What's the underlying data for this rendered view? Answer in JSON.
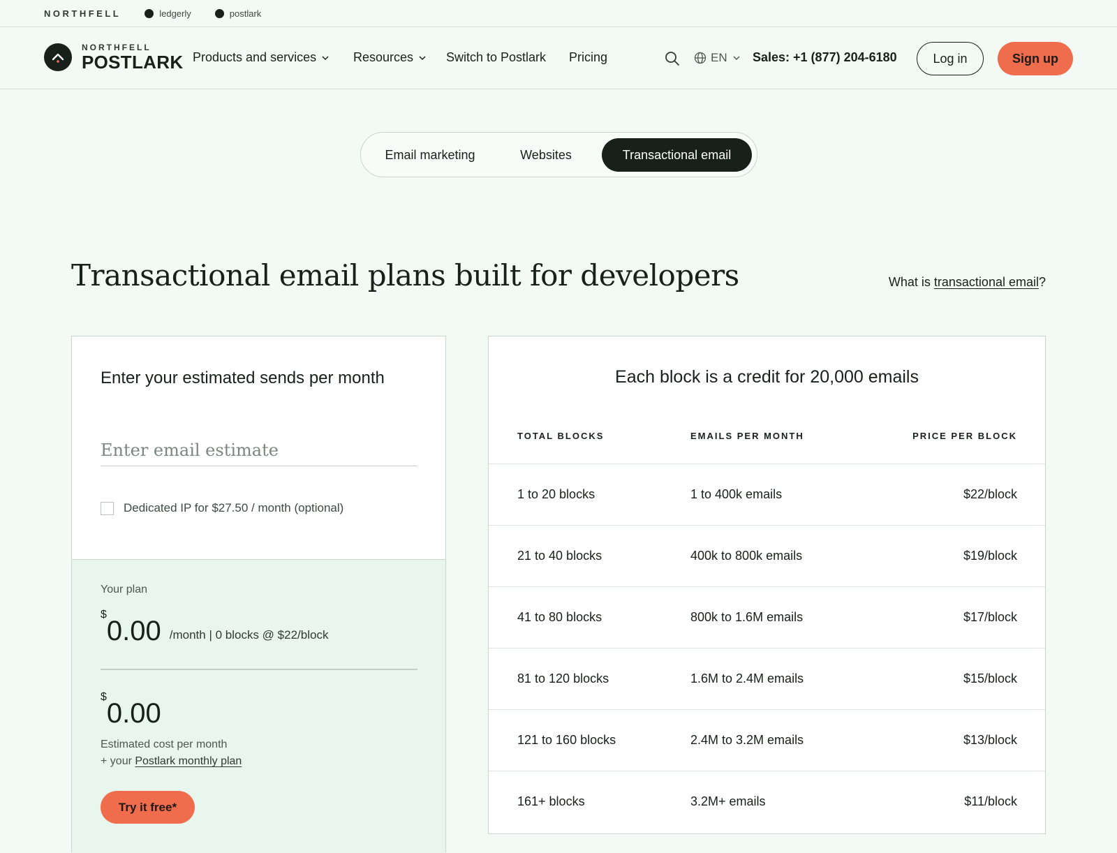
{
  "utility_bar": {
    "brand": "NORTHFELL",
    "links": [
      "ledgerly",
      "postlark"
    ]
  },
  "nav": {
    "logo_small": "NORTHFELL",
    "logo_big": "POSTLARK",
    "items": [
      {
        "label": "Products and services",
        "has_dropdown": true
      },
      {
        "label": "Resources",
        "has_dropdown": true
      },
      {
        "label": "Switch to Postlark",
        "has_dropdown": false
      },
      {
        "label": "Pricing",
        "has_dropdown": false
      }
    ],
    "language": "EN",
    "sales": "Sales: +1 (877) 204-6180",
    "login_label": "Log in",
    "signup_label": "Sign up"
  },
  "tabs": [
    {
      "label": "Email marketing",
      "active": false
    },
    {
      "label": "Websites",
      "active": false
    },
    {
      "label": "Transactional email",
      "active": true
    }
  ],
  "page": {
    "title": "Transactional email plans built for developers",
    "what_is_prefix": "What is ",
    "what_is_link": "transactional email",
    "what_is_suffix": "?"
  },
  "estimator": {
    "heading": "Enter your estimated sends per month",
    "input_placeholder": "Enter email estimate",
    "input_value": "",
    "dedicated_ip_label": "Dedicated IP for $27.50 / month (optional)",
    "dedicated_ip_checked": false,
    "plan_label": "Your plan",
    "currency": "$",
    "price": "0.00",
    "price_detail": "/month | 0 blocks @ $22/block",
    "total": "0.00",
    "estimated_label": "Estimated cost per month",
    "plan_note_prefix": "+ your ",
    "plan_note_link": "Postlark monthly plan",
    "try_label": "Try it free*"
  },
  "pricing_table": {
    "heading": "Each block is a credit for 20,000 emails",
    "columns": [
      "TOTAL BLOCKS",
      "EMAILS PER MONTH",
      "PRICE PER BLOCK"
    ],
    "rows": [
      {
        "blocks": "1 to 20 blocks",
        "emails": "1 to 400k emails",
        "price": "$22/block"
      },
      {
        "blocks": "21 to 40 blocks",
        "emails": "400k to 800k emails",
        "price": "$19/block"
      },
      {
        "blocks": "41 to 80 blocks",
        "emails": "800k to 1.6M emails",
        "price": "$17/block"
      },
      {
        "blocks": "81 to 120 blocks",
        "emails": "1.6M to 2.4M emails",
        "price": "$15/block"
      },
      {
        "blocks": "121 to 160 blocks",
        "emails": "2.4M to 3.2M emails",
        "price": "$13/block"
      },
      {
        "blocks": "161+ blocks",
        "emails": "3.2M+ emails",
        "price": "$11/block"
      }
    ]
  },
  "colors": {
    "background": "#f3faf6",
    "ink": "#17201b",
    "accent": "#ef6c4d",
    "plan_panel": "#e8f6ed"
  }
}
